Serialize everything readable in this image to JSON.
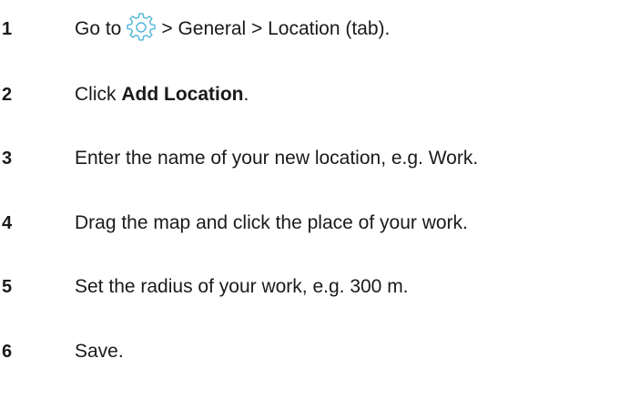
{
  "steps": [
    {
      "number": "1",
      "prefix": "Go to",
      "icon": "gear-icon",
      "suffix": "> General > Location (tab)."
    },
    {
      "number": "2",
      "prefix": "Click ",
      "bold": "Add Location",
      "suffix": "."
    },
    {
      "number": "3",
      "text": "Enter the name of your new location, e.g. Work."
    },
    {
      "number": "4",
      "text": "Drag the map and click the place of your work."
    },
    {
      "number": "5",
      "text": "Set the radius of your work, e.g. 300 m."
    },
    {
      "number": "6",
      "text": "Save."
    }
  ],
  "colors": {
    "text": "#1a1a1a",
    "icon": "#4fb3d9"
  }
}
